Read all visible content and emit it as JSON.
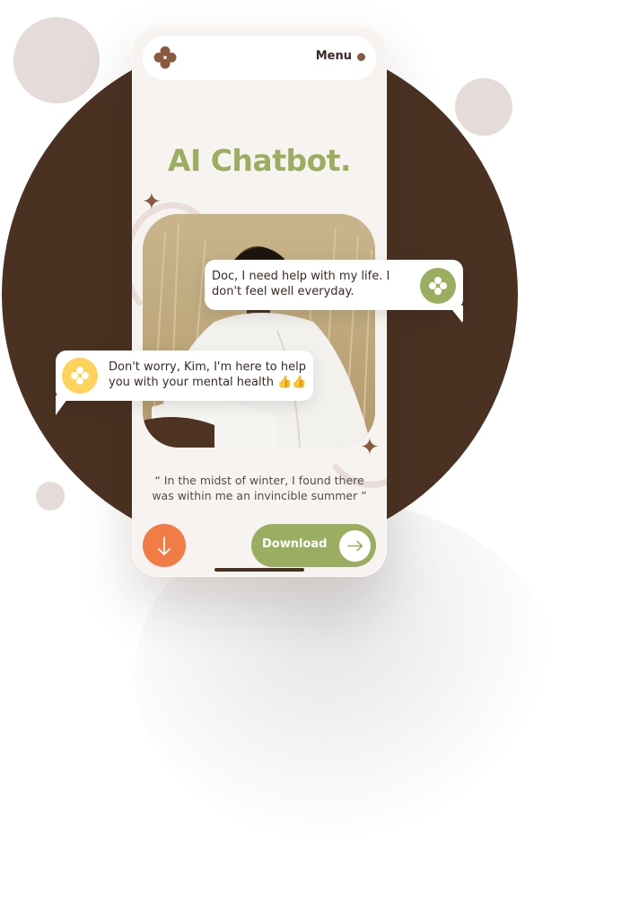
{
  "app": {
    "menu_label": "Menu",
    "title": "AI Chatbot.",
    "quote": "“ In the midst of winter, I found there was within me an invincible summer ”",
    "download_label": "Download"
  },
  "chat": {
    "user_message": "Doc, I need help with my life. I don't feel well everyday.",
    "bot_message": "Don't worry, Kim, I'm here to help you with your mental health 👍👍"
  },
  "icons": {
    "logo": "four-petal-logo-icon",
    "menu_dot": "dot-icon",
    "download_arrow": "arrow-down-icon",
    "right_arrow": "arrow-right-icon",
    "sparkle": "sparkle-icon",
    "bot_avatar": "four-petal-avatar-icon"
  },
  "colors": {
    "background_circle": "#4a3122",
    "accent_green": "#9aad60",
    "accent_orange": "#f27c45",
    "accent_yellow": "#ffd35a",
    "brand_brown": "#8a5a40",
    "phone_bg": "#f7f3f0"
  }
}
